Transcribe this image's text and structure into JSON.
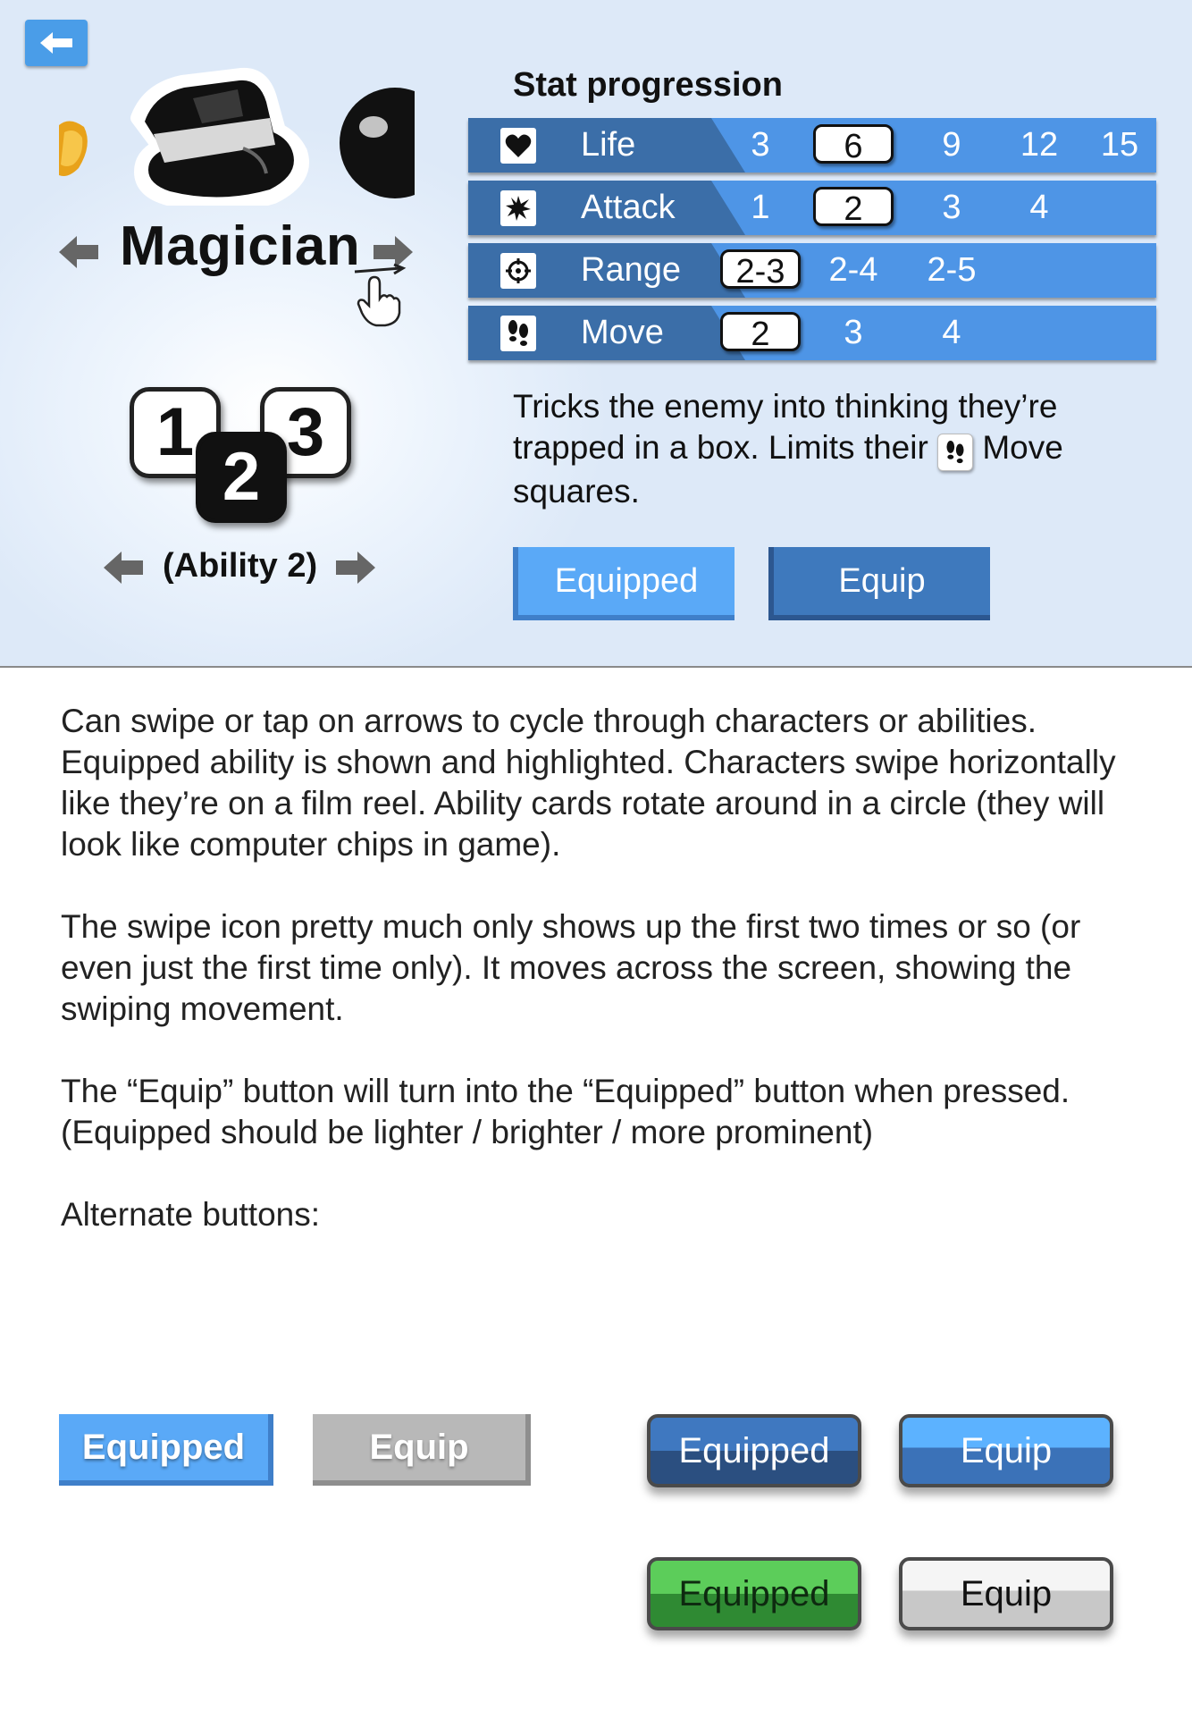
{
  "mockup": {
    "character_name": "Magician",
    "ability_chips": [
      "1",
      "2",
      "3"
    ],
    "active_ability_index": 2,
    "ability_label": "(Ability 2)",
    "stat_title": "Stat progression",
    "stats": [
      {
        "name": "Life",
        "icon": "heart-icon",
        "values": [
          "3",
          "6",
          "9",
          "12",
          "15"
        ],
        "selected": "6"
      },
      {
        "name": "Attack",
        "icon": "burst-icon",
        "values": [
          "1",
          "2",
          "3",
          "4"
        ],
        "selected": "2"
      },
      {
        "name": "Range",
        "icon": "crosshair-icon",
        "values": [
          "2-3",
          "2-4",
          "2-5"
        ],
        "selected": "2-3"
      },
      {
        "name": "Move",
        "icon": "footprints-icon",
        "values": [
          "2",
          "3",
          "4"
        ],
        "selected": "2"
      }
    ],
    "description": {
      "before": "Tricks the enemy into thinking they’re trapped in a box.  Limits their",
      "after": "Move squares."
    },
    "buttons": {
      "equipped": "Equipped",
      "equip": "Equip"
    }
  },
  "notes": [
    "Can swipe or tap on arrows to cycle through characters or abilities. Equipped ability is shown and highlighted.  Characters swipe horizontally like they’re on a film reel.  Ability cards rotate around in a circle (they will look like computer chips in game).",
    "The swipe icon pretty much only shows up the first two times or so (or even just the first time only). It moves across the screen, showing the swiping movement.",
    "The “Equip” button will turn into the “Equipped” button when pressed. (Equipped should be lighter / brighter / more prominent)",
    "Alternate buttons:"
  ],
  "alternate_buttons": {
    "flat_equipped": "Equipped",
    "flat_equip": "Equip",
    "round_dark_equipped": "Equipped",
    "round_blue_equip": "Equip",
    "round_green_equipped": "Equipped",
    "round_gray_equip": "Equip"
  },
  "colors": {
    "stat_row": "#4e95e6",
    "stat_label": "#3b6ea8",
    "equipped": "#5aa9f7",
    "equip": "#3e79bd"
  }
}
